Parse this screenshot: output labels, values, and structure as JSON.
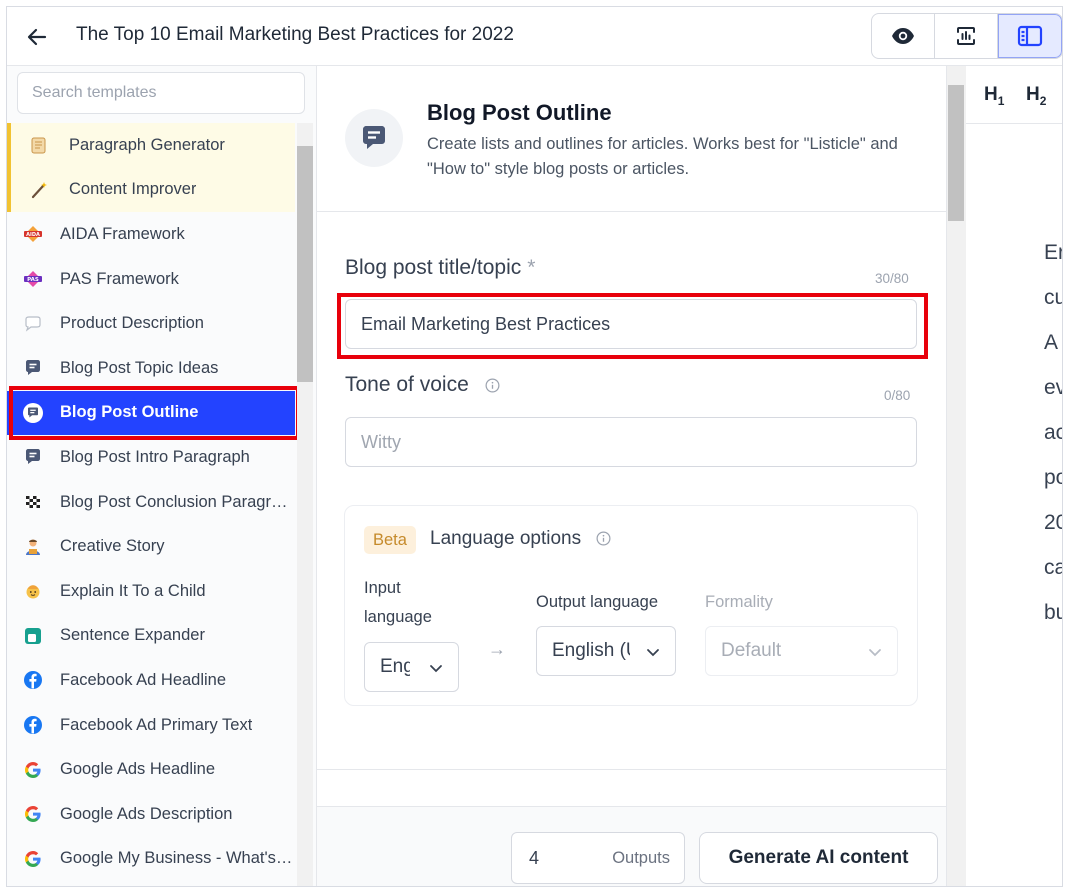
{
  "header": {
    "doc_title": "The Top 10 Email Marketing Best Practices for 2022",
    "view_buttons": [
      "eye-icon",
      "stats-icon",
      "layout-icon"
    ]
  },
  "sidebar": {
    "search_placeholder": "Search templates",
    "items": [
      {
        "label": "Paragraph Generator",
        "icon": "scroll-icon",
        "favorite": true
      },
      {
        "label": "Content Improver",
        "icon": "magic-wand-icon",
        "favorite": true
      },
      {
        "label": "AIDA Framework",
        "icon": "aida-icon"
      },
      {
        "label": "PAS Framework",
        "icon": "pas-icon"
      },
      {
        "label": "Product Description",
        "icon": "speech-bubble-icon"
      },
      {
        "label": "Blog Post Topic Ideas",
        "icon": "chat-icon"
      },
      {
        "label": "Blog Post Outline",
        "icon": "chat-icon",
        "active": true
      },
      {
        "label": "Blog Post Intro Paragraph",
        "icon": "chat-icon"
      },
      {
        "label": "Blog Post Conclusion Paragraph",
        "icon": "checkered-flag-icon"
      },
      {
        "label": "Creative Story",
        "icon": "storyteller-icon"
      },
      {
        "label": "Explain It To a Child",
        "icon": "child-icon"
      },
      {
        "label": "Sentence Expander",
        "icon": "expand-icon"
      },
      {
        "label": "Facebook Ad Headline",
        "icon": "facebook-icon"
      },
      {
        "label": "Facebook Ad Primary Text",
        "icon": "facebook-icon"
      },
      {
        "label": "Google Ads Headline",
        "icon": "google-icon"
      },
      {
        "label": "Google Ads Description",
        "icon": "google-icon"
      },
      {
        "label": "Google My Business - What's New Post",
        "icon": "google-icon"
      }
    ]
  },
  "template": {
    "name": "Blog Post Outline",
    "description": "Create lists and outlines for articles. Works best for \"Listicle\" and \"How to\" style blog posts or articles."
  },
  "form": {
    "title_label": "Blog post title/topic",
    "title_required": "*",
    "title_counter": "30/80",
    "title_value": "Email Marketing Best Practices",
    "tone_label": "Tone of voice",
    "tone_counter": "0/80",
    "tone_placeholder": "Witty"
  },
  "language": {
    "badge": "Beta",
    "title": "Language options",
    "input_label": "Input language",
    "input_value": "English",
    "output_label": "Output language",
    "output_value": "English (US)",
    "formality_label": "Formality",
    "formality_value": "Default"
  },
  "generate": {
    "outputs_value": "4",
    "outputs_label": "Outputs",
    "button_label": "Generate AI content"
  },
  "editor": {
    "h1": "H1",
    "h2": "H2",
    "text_lines": [
      "Er",
      "cu",
      "A",
      "ev",
      "ac",
      "po",
      "20",
      "ca",
      "bu"
    ]
  },
  "colors": {
    "accent": "#2343ff",
    "highlight_box": "#e8000b",
    "favorite_bg": "#fefbe6",
    "favorite_border": "#f1c232",
    "beta_bg": "#fdf0dc",
    "beta_text": "#c58a2b"
  }
}
